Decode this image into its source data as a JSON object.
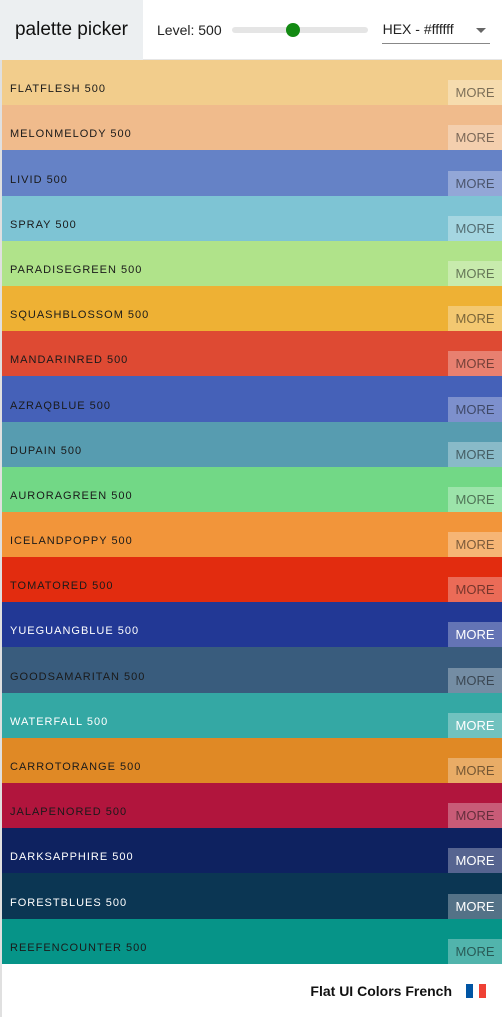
{
  "navbar": {
    "logo": "palette picker",
    "level_label": "Level: 500",
    "level_value_fraction": 0.45,
    "format_value": "HEX - #ffffff"
  },
  "more_label": "MORE",
  "colors": [
    {
      "name": "FLATFLESH 500",
      "hex": "#f2cd8c",
      "text": "#1a1a1a"
    },
    {
      "name": "MELONMELODY 500",
      "hex": "#f0bb8c",
      "text": "#1a1a1a"
    },
    {
      "name": "LIVID 500",
      "hex": "#6582c6",
      "text": "#1a1a1a"
    },
    {
      "name": "SPRAY 500",
      "hex": "#7ec4d4",
      "text": "#1a1a1a"
    },
    {
      "name": "PARADISEGREEN 500",
      "hex": "#b0e38a",
      "text": "#1a1a1a"
    },
    {
      "name": "SQUASHBLOSSOM 500",
      "hex": "#eeb134",
      "text": "#1a1a1a"
    },
    {
      "name": "MANDARINRED 500",
      "hex": "#de4a33",
      "text": "#1a1a1a"
    },
    {
      "name": "AZRAQBLUE 500",
      "hex": "#4561b8",
      "text": "#1a1a1a"
    },
    {
      "name": "DUPAIN 500",
      "hex": "#579cb0",
      "text": "#1a1a1a"
    },
    {
      "name": "AURORAGREEN 500",
      "hex": "#72d886",
      "text": "#1a1a1a"
    },
    {
      "name": "ICELANDPOPPY 500",
      "hex": "#f2953a",
      "text": "#1a1a1a"
    },
    {
      "name": "TOMATORED 500",
      "hex": "#e22c0f",
      "text": "#1a1a1a"
    },
    {
      "name": "YUEGUANGBLUE 500",
      "hex": "#223895",
      "text": "#ffffff"
    },
    {
      "name": "GOODSAMARITAN 500",
      "hex": "#395c7d",
      "text": "#1a1a1a"
    },
    {
      "name": "WATERFALL 500",
      "hex": "#34a8a4",
      "text": "#ffffff"
    },
    {
      "name": "CARROTORANGE 500",
      "hex": "#e08925",
      "text": "#1a1a1a"
    },
    {
      "name": "JALAPENORED 500",
      "hex": "#b1153d",
      "text": "#1a1a1a"
    },
    {
      "name": "DARKSAPPHIRE 500",
      "hex": "#0e2260",
      "text": "#ffffff"
    },
    {
      "name": "FORESTBLUES 500",
      "hex": "#0b3653",
      "text": "#ffffff"
    },
    {
      "name": "REEFENCOUNTER 500",
      "hex": "#069488",
      "text": "#1a1a1a"
    }
  ],
  "footer": {
    "text": "Flat UI Colors French",
    "flag_colors": [
      "#0055a4",
      "#ffffff",
      "#ef4135"
    ]
  }
}
